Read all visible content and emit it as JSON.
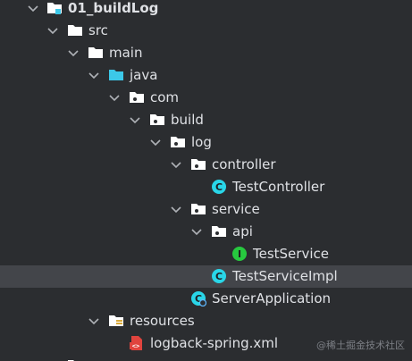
{
  "project_tree": {
    "root": {
      "label": "01_buildLog"
    },
    "src": {
      "label": "src"
    },
    "main": {
      "label": "main"
    },
    "java": {
      "label": "java"
    },
    "com": {
      "label": "com"
    },
    "build": {
      "label": "build"
    },
    "log": {
      "label": "log"
    },
    "controller": {
      "label": "controller"
    },
    "test_controller": {
      "label": "TestController",
      "icon_letter": "C"
    },
    "service": {
      "label": "service"
    },
    "api": {
      "label": "api"
    },
    "test_service": {
      "label": "TestService",
      "icon_letter": "I"
    },
    "test_service_impl": {
      "label": "TestServiceImpl",
      "icon_letter": "C"
    },
    "server_application": {
      "label": "ServerApplication",
      "icon_letter": "C"
    },
    "resources": {
      "label": "resources"
    },
    "logback": {
      "label": "logback-spring.xml",
      "icon_text": "<>"
    }
  },
  "watermark": "@稀土掘金技术社区",
  "colors": {
    "background": "#2b2d30",
    "selected_row": "#43454a",
    "text": "#dfe1e5",
    "class_icon": "#29d6e8",
    "interface_icon": "#27c93f",
    "java_folder": "#3cc8e8",
    "xml_icon": "#e0443e"
  }
}
